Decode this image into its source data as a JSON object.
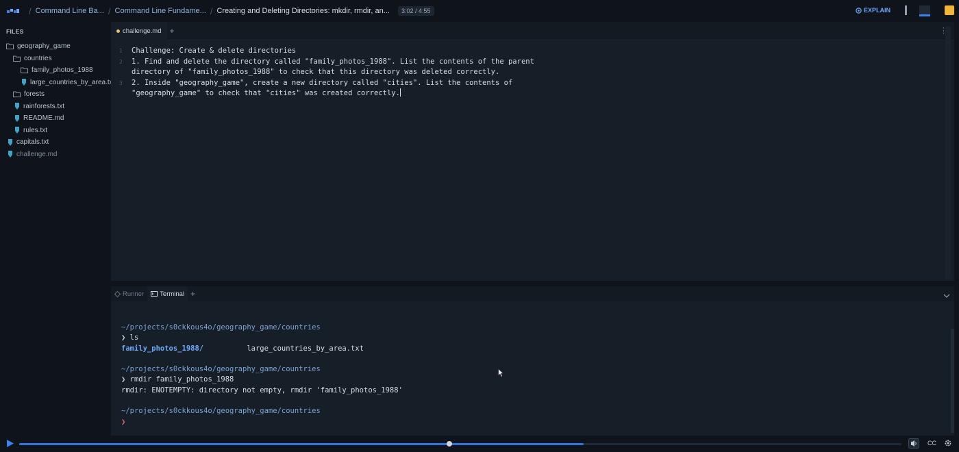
{
  "topbar": {
    "crumbs": [
      "Command Line Ba...",
      "Command Line Fundame...",
      "Creating and Deleting Directories: mkdir, rmdir, an..."
    ],
    "timer": "3:02 / 4:55",
    "explain_label": "EXPLAIN"
  },
  "sidebar": {
    "title": "FILES",
    "items": [
      {
        "label": "geography_game",
        "type": "folder"
      },
      {
        "label": "countries",
        "type": "folder"
      },
      {
        "label": "family_photos_1988",
        "type": "folder"
      },
      {
        "label": "large_countries_by_area.txt",
        "type": "file"
      },
      {
        "label": "forests",
        "type": "folder"
      },
      {
        "label": "rainforests.txt",
        "type": "file"
      },
      {
        "label": "README.md",
        "type": "file"
      },
      {
        "label": "rules.txt",
        "type": "file"
      },
      {
        "label": "capitals.txt",
        "type": "file"
      },
      {
        "label": "challenge.md",
        "type": "file"
      }
    ]
  },
  "editor": {
    "tab": "challenge.md",
    "lines": [
      {
        "num": "1",
        "text": "Challenge: Create & delete directories"
      },
      {
        "num": "2",
        "text": "1. Find and delete the directory called \"family_photos_1988\". List the contents of the parent"
      },
      {
        "num": "",
        "text": "directory of \"family_photos_1988\" to check that this directory was deleted correctly."
      },
      {
        "num": "3",
        "text": "2. Inside \"geography_game\", create a new directory called \"cities\". List the contents of"
      },
      {
        "num": "",
        "text": "\"geography_game\" to check that \"cities\" was created correctly."
      }
    ]
  },
  "terminal": {
    "tabs": [
      "Runner",
      "Terminal"
    ],
    "path": "~/projects/s0ckkous4o/geography_game/countries",
    "prompt_char": "❯",
    "cmd1": "ls",
    "ls_dir": "family_photos_1988/",
    "ls_file": "large_countries_by_area.txt",
    "cmd2": "rmdir family_photos_1988",
    "error": "rmdir: ENOTEMPTY: directory not empty, rmdir 'family_photos_1988'"
  },
  "player": {
    "progress": 0.64,
    "cc_label": "CC"
  },
  "colors": {
    "accent": "#2f74e4",
    "folder": "#8896a3",
    "file_icon": "#3fa3c7"
  }
}
